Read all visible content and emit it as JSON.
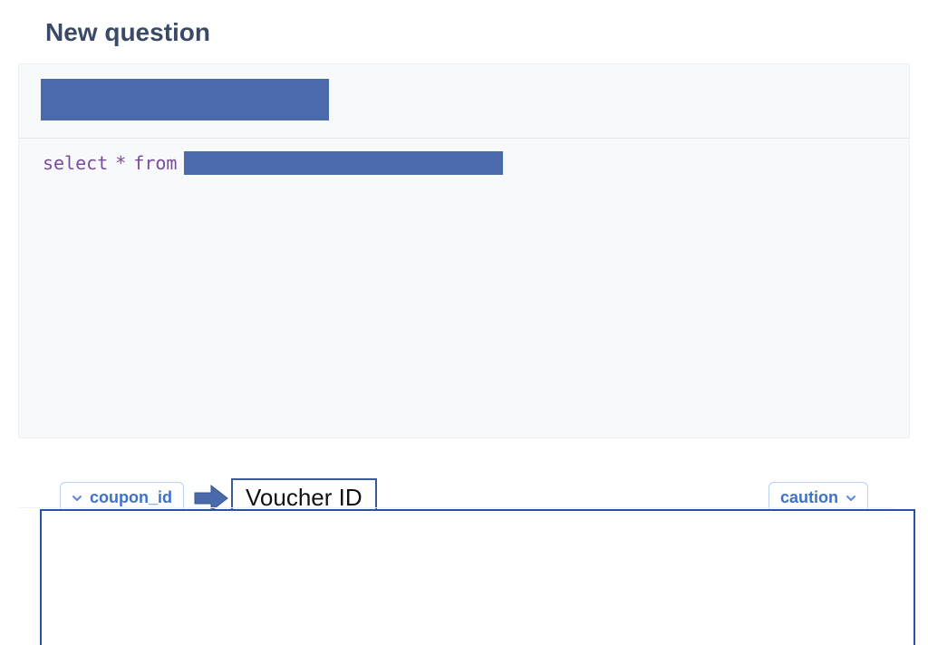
{
  "header": {
    "title": "New question"
  },
  "editor": {
    "sql": {
      "prefix": "select",
      "star": "*",
      "from": "from"
    }
  },
  "chips": {
    "left_column_name": "coupon_id",
    "right_column_name": "caution"
  },
  "annotation": {
    "label": "Voucher ID"
  },
  "colors": {
    "redaction": "#4a6aab",
    "accent": "#3d72c9",
    "title": "#3a4a66",
    "border_accent": "#2a52a3"
  }
}
